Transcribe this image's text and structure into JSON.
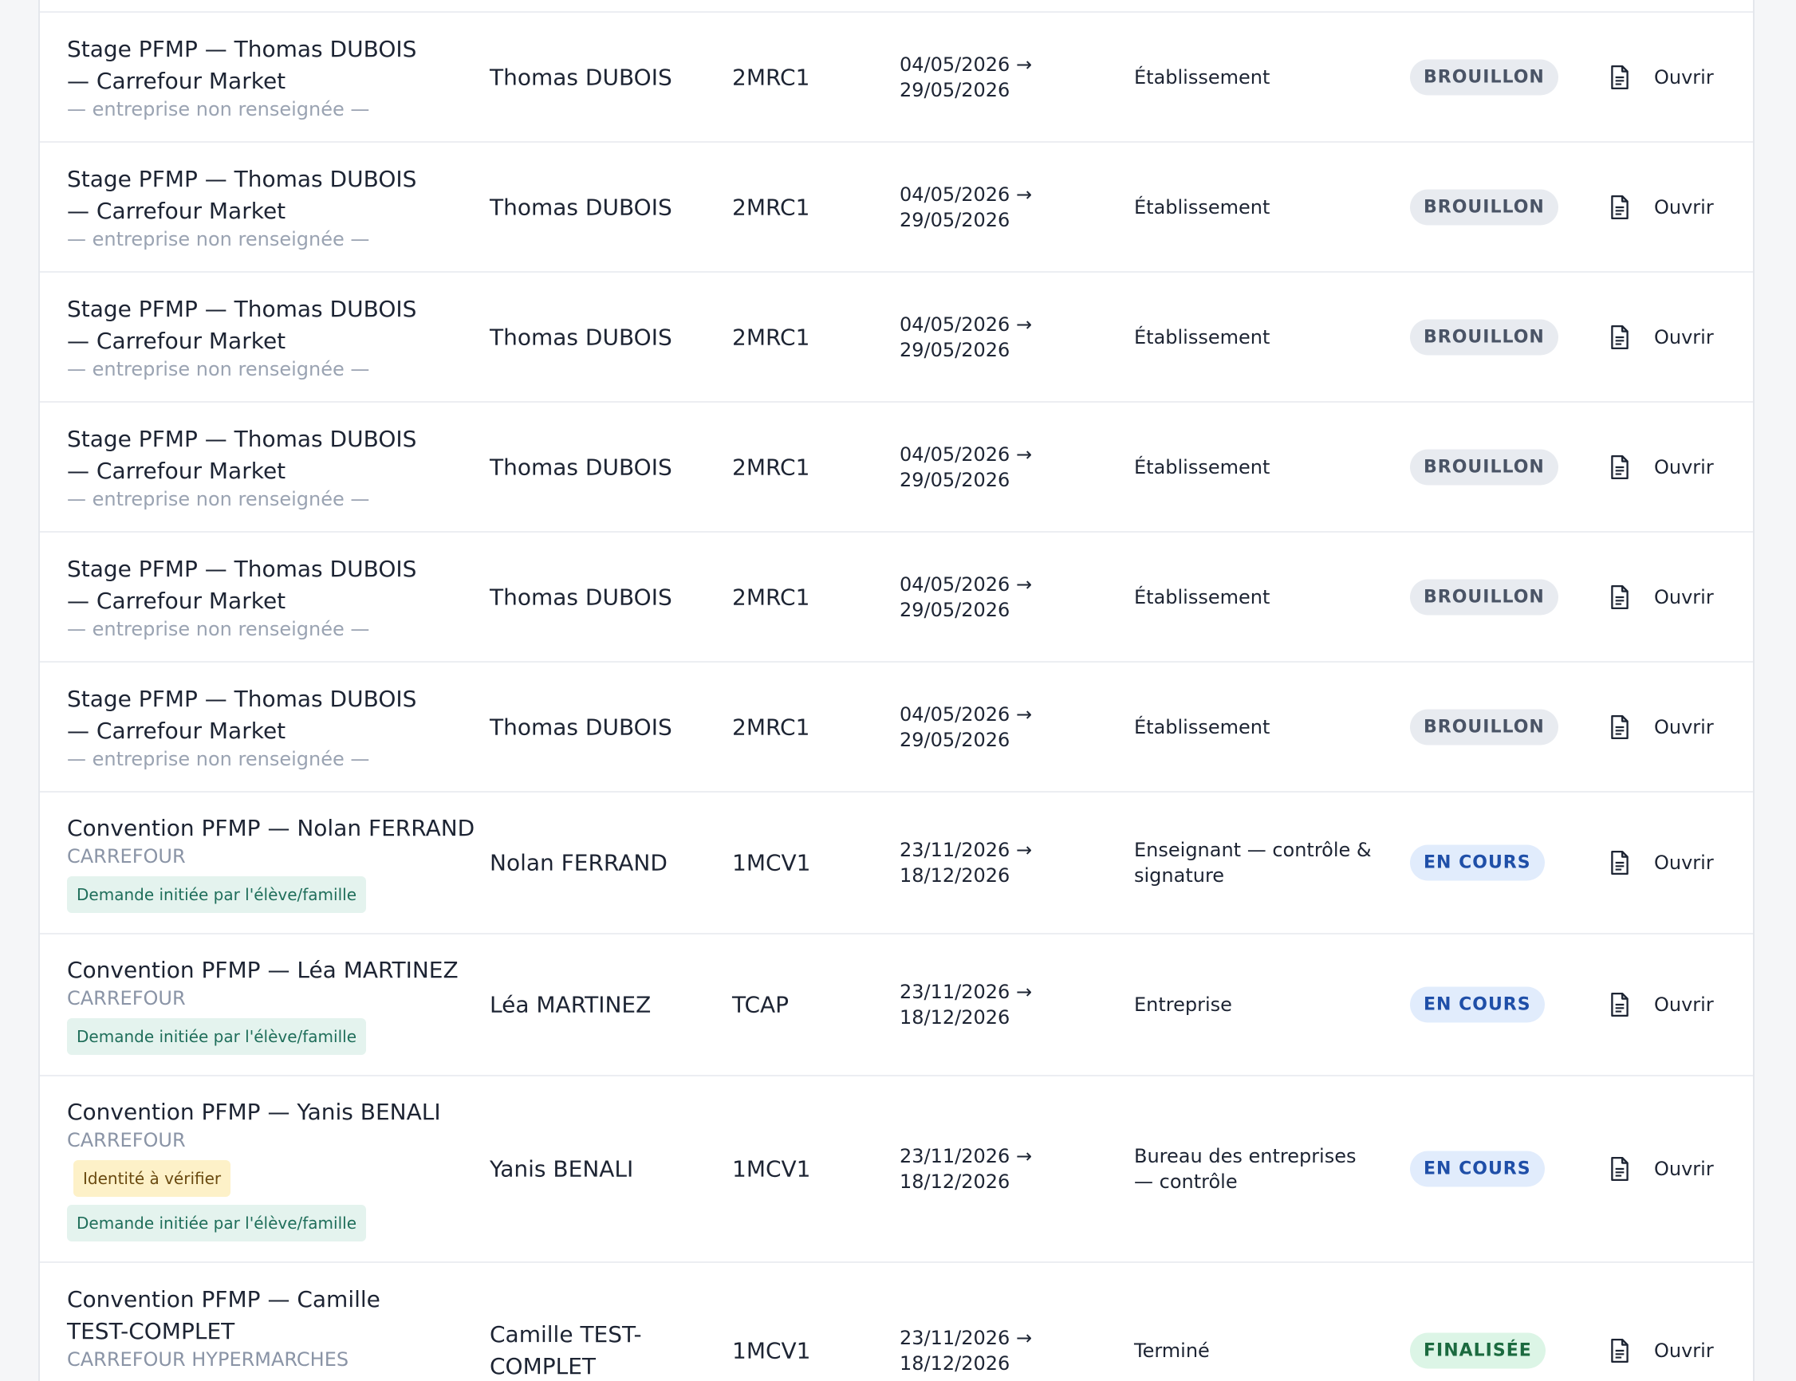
{
  "action_label": "Ouvrir",
  "rows": [
    {
      "title": "Stage PFMP — Thomas DUBOIS — Carrefour Market",
      "company": "— entreprise non renseignée —",
      "tags": [],
      "student": "Thomas DUBOIS",
      "class": "2MRC1",
      "dates": "04/05/2026 → 29/05/2026",
      "step": "Établissement",
      "status": "BROUILLON"
    },
    {
      "title": "Stage PFMP — Thomas DUBOIS — Carrefour Market",
      "company": "— entreprise non renseignée —",
      "tags": [],
      "student": "Thomas DUBOIS",
      "class": "2MRC1",
      "dates": "04/05/2026 → 29/05/2026",
      "step": "Établissement",
      "status": "BROUILLON"
    },
    {
      "title": "Stage PFMP — Thomas DUBOIS — Carrefour Market",
      "company": "— entreprise non renseignée —",
      "tags": [],
      "student": "Thomas DUBOIS",
      "class": "2MRC1",
      "dates": "04/05/2026 → 29/05/2026",
      "step": "Établissement",
      "status": "BROUILLON"
    },
    {
      "title": "Stage PFMP — Thomas DUBOIS — Carrefour Market",
      "company": "— entreprise non renseignée —",
      "tags": [],
      "student": "Thomas DUBOIS",
      "class": "2MRC1",
      "dates": "04/05/2026 → 29/05/2026",
      "step": "Établissement",
      "status": "BROUILLON"
    },
    {
      "title": "Stage PFMP — Thomas DUBOIS — Carrefour Market",
      "company": "— entreprise non renseignée —",
      "tags": [],
      "student": "Thomas DUBOIS",
      "class": "2MRC1",
      "dates": "04/05/2026 → 29/05/2026",
      "step": "Établissement",
      "status": "BROUILLON"
    },
    {
      "title": "Stage PFMP — Thomas DUBOIS — Carrefour Market",
      "company": "— entreprise non renseignée —",
      "tags": [],
      "student": "Thomas DUBOIS",
      "class": "2MRC1",
      "dates": "04/05/2026 → 29/05/2026",
      "step": "Établissement",
      "status": "BROUILLON"
    },
    {
      "title": "Convention PFMP — Nolan FERRAND",
      "company": "CARREFOUR",
      "tags": [
        "Demande initiée par l'élève/famille"
      ],
      "student": "Nolan FERRAND",
      "class": "1MCV1",
      "dates": "23/11/2026 → 18/12/2026",
      "step": "Enseignant — contrôle & signature",
      "status": "EN COURS"
    },
    {
      "title": "Convention PFMP — Léa MARTINEZ",
      "company": "CARREFOUR",
      "tags": [
        "Demande initiée par l'élève/famille"
      ],
      "student": "Léa MARTINEZ",
      "class": "TCAP",
      "dates": "23/11/2026 → 18/12/2026",
      "step": "Entreprise",
      "status": "EN COURS"
    },
    {
      "title": "Convention PFMP — Yanis BENALI",
      "company": "CARREFOUR",
      "tags": [
        "Identité à vérifier",
        "Demande initiée par l'élève/famille"
      ],
      "student": "Yanis BENALI",
      "class": "1MCV1",
      "dates": "23/11/2026 → 18/12/2026",
      "step": "Bureau des entreprises — contrôle",
      "status": "EN COURS"
    },
    {
      "title": "Convention PFMP — Camille TEST-COMPLET",
      "company": "CARREFOUR HYPERMARCHES",
      "tags": [],
      "student": "Camille TEST-COMPLET",
      "class": "1MCV1",
      "dates": "23/11/2026 → 18/12/2026",
      "step": "Terminé",
      "status": "FINALISÉE"
    }
  ]
}
